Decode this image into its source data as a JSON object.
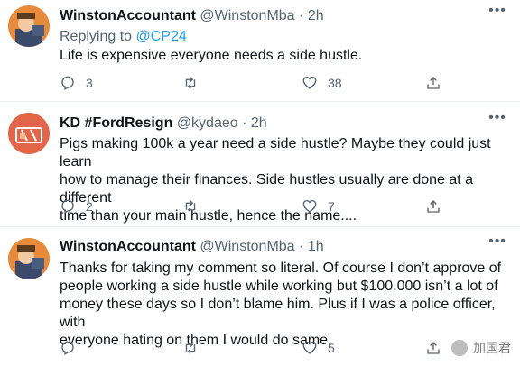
{
  "tweets": [
    {
      "name": "WinstonAccountant",
      "handle": "@WinstonMba",
      "dot": "·",
      "time": "2h",
      "replying_prefix": "Replying to ",
      "replying_to": "@CP24",
      "text": "Life is expensive everyone needs a side hustle.",
      "reply_count": "3",
      "retweet_count": "",
      "like_count": "38"
    },
    {
      "name": "KD #FordResign",
      "handle": "@kydaeo",
      "dot": "·",
      "time": "2h",
      "text": "Pigs making 100k a year need a side hustle? Maybe they could just learn\nhow to manage their finances. Side hustles usually are done at a different\ntime than your main hustle, hence the name....",
      "reply_count": "2",
      "retweet_count": "",
      "like_count": "7"
    },
    {
      "name": "WinstonAccountant",
      "handle": "@WinstonMba",
      "dot": "·",
      "time": "1h",
      "text": "Thanks for taking my comment so literal. Of course I don’t approve of\npeople working a side hustle while working but $100,000 isn’t a lot of\nmoney these days so I don’t blame him. Plus if I was a police officer, with\neveryone hating on them I would do same.",
      "reply_count": "",
      "retweet_count": "",
      "like_count": "5"
    }
  ],
  "more_icon": "more-dots-icon",
  "watermark": {
    "text": "加国君"
  },
  "colors": {
    "link": "#1d9bf0",
    "secondary": "#536471",
    "divider": "#e6ecf0"
  }
}
